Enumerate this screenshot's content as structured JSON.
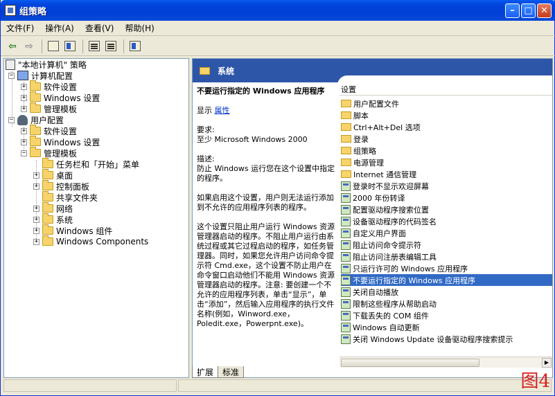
{
  "window": {
    "title": "组策略"
  },
  "menu": [
    "文件(F)",
    "操作(A)",
    "查看(V)",
    "帮助(H)"
  ],
  "tree": {
    "root": "\"本地计算机\" 策略",
    "computer_config": "计算机配置",
    "user_config": "用户配置",
    "software_settings": "软件设置",
    "windows_settings": "Windows 设置",
    "admin_templates": "管理模板",
    "user_admin_children": [
      "任务栏和「开始」菜单",
      "桌面",
      "控制面板",
      "共享文件夹",
      "网络",
      "系统",
      "Windows 组件",
      "Windows Components"
    ]
  },
  "content": {
    "header": "系统",
    "desc_title": "不要运行指定的 Windows 应用程序",
    "show_label": "显示",
    "properties_link": "属性",
    "req_label": "要求:",
    "req_value": "至少 Microsoft Windows 2000",
    "desc_label": "描述:",
    "desc_p1": "防止 Windows 运行您在这个设置中指定的程序。",
    "desc_p2": "如果启用这个设置，用户则无法运行添加到不允许的应用程序列表的程序。",
    "desc_p3": "这个设置只阻止用户运行 Windows 资源管理器启动的程序。不阻止用户运行由系统过程或其它过程启动的程序，如任务管理器。同时，如果您允许用户访问命令提示符 Cmd.exe，这个设置不防止用户在命令窗口启动他们不能用 Windows 资源管理器启动的程序。注意: 要创建一个不允许的应用程序列表，单击“显示”，单击“添加”，然后输入应用程序的执行文件名称(例如，Winword.exe，Poledit.exe，Powerpnt.exe)。",
    "settings_header": "设置",
    "settings": [
      {
        "label": "用户配置文件",
        "kind": "folder"
      },
      {
        "label": "脚本",
        "kind": "folder"
      },
      {
        "label": "Ctrl+Alt+Del 选项",
        "kind": "folder"
      },
      {
        "label": "登录",
        "kind": "folder"
      },
      {
        "label": "组策略",
        "kind": "folder"
      },
      {
        "label": "电源管理",
        "kind": "folder"
      },
      {
        "label": "Internet 通信管理",
        "kind": "folder"
      },
      {
        "label": "登录时不显示欢迎屏幕",
        "kind": "setting"
      },
      {
        "label": "2000 年份转译",
        "kind": "setting"
      },
      {
        "label": "配置驱动程序搜索位置",
        "kind": "setting"
      },
      {
        "label": "设备驱动程序的代码签名",
        "kind": "setting"
      },
      {
        "label": "自定义用户界面",
        "kind": "setting"
      },
      {
        "label": "阻止访问命令提示符",
        "kind": "setting"
      },
      {
        "label": "阻止访问注册表编辑工具",
        "kind": "setting"
      },
      {
        "label": "只运行许可的 Windows 应用程序",
        "kind": "setting"
      },
      {
        "label": "不要运行指定的 Windows 应用程序",
        "kind": "setting",
        "selected": true
      },
      {
        "label": "关闭自动播放",
        "kind": "setting"
      },
      {
        "label": "限制这些程序从帮助启动",
        "kind": "setting"
      },
      {
        "label": "下载丢失的 COM 组件",
        "kind": "setting"
      },
      {
        "label": "Windows 自动更新",
        "kind": "setting"
      },
      {
        "label": "关闭 Windows Update 设备驱动程序搜索提示",
        "kind": "setting"
      }
    ]
  },
  "tabs": [
    "扩展",
    "标准"
  ],
  "watermark": "图4"
}
